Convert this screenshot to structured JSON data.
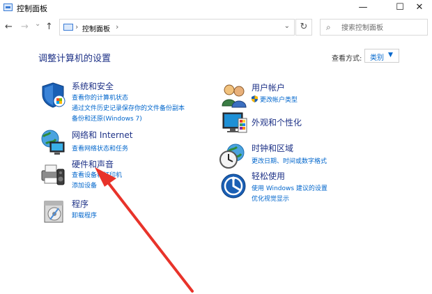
{
  "window": {
    "title": "控制面板",
    "minimize": "—",
    "maximize": "☐",
    "close": "✕"
  },
  "nav": {
    "back": "←",
    "forward": "→",
    "recent": "⌄",
    "up": "↑"
  },
  "address": {
    "sep1": "›",
    "crumb": "控制面板",
    "sep2": "›",
    "dropdown": "⌄",
    "refresh": "↻"
  },
  "search": {
    "placeholder": "搜索控制面板",
    "icon": "⌕"
  },
  "page": {
    "title": "调整计算机的设置",
    "view_label": "查看方式:",
    "view_value": "类别",
    "view_caret": "▼"
  },
  "categories": [
    {
      "icon": "shield-flag-icon",
      "title": "系统和安全",
      "links": [
        "查看你的计算机状态",
        "通过文件历史记录保存你的文件备份副本",
        "备份和还原(Windows 7)"
      ]
    },
    {
      "icon": "network-globe-icon",
      "title": "网络和 Internet",
      "links": [
        "查看网络状态和任务"
      ]
    },
    {
      "icon": "printer-speaker-icon",
      "title": "硬件和声音",
      "links": [
        "查看设备和打印机",
        "添加设备"
      ]
    },
    {
      "icon": "program-disc-icon",
      "title": "程序",
      "links": [
        "卸载程序"
      ]
    },
    {
      "icon": "users-icon",
      "title": "用户帐户",
      "links": [
        "更改帐户类型"
      ]
    },
    {
      "icon": "monitor-palette-icon",
      "title": "外观和个性化",
      "links": []
    },
    {
      "icon": "clock-globe-icon",
      "title": "时钟和区域",
      "links": [
        "更改日期、时间或数字格式"
      ]
    },
    {
      "icon": "ease-of-access-icon",
      "title": "轻松使用",
      "links": [
        "使用 Windows 建议的设置",
        "优化视觉显示"
      ]
    }
  ],
  "colors": {
    "heading": "#1e3287",
    "link": "#0066cc",
    "annotation_arrow": "#e8332a"
  }
}
